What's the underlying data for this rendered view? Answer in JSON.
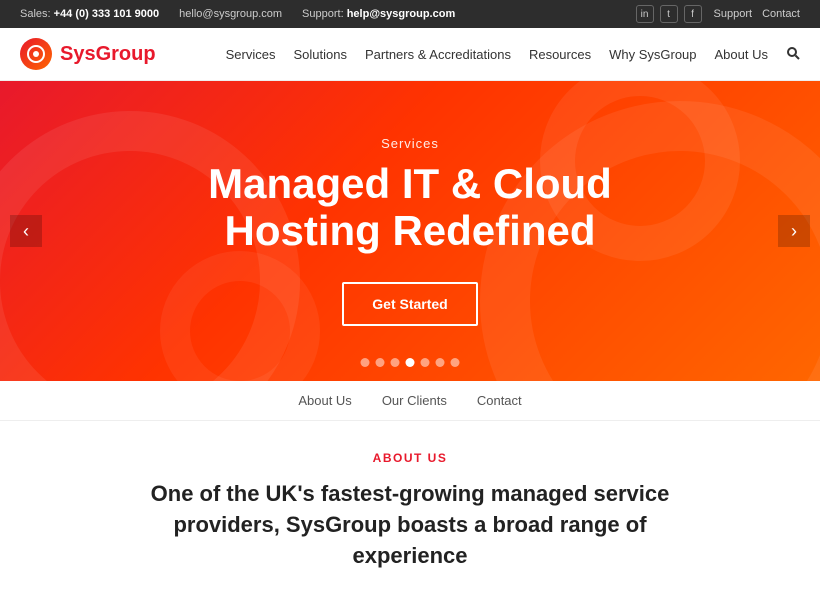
{
  "topbar": {
    "sales_label": "Sales:",
    "sales_phone": "+44 (0) 333 101 9000",
    "email_label": "hello@sysgroup.com",
    "support_label": "Support:",
    "support_email": "help@sysgroup.com",
    "links": [
      "Support",
      "Contact"
    ],
    "social": [
      "in",
      "t",
      "f"
    ]
  },
  "header": {
    "logo_text_sys": "Sys",
    "logo_text_group": "Group",
    "nav_items": [
      "Services",
      "Solutions",
      "Partners & Accreditations",
      "Resources",
      "Why SysGroup",
      "About Us"
    ]
  },
  "hero": {
    "subtitle": "Services",
    "title_line1": "Managed IT & Cloud",
    "title_line2": "Hosting Redefined",
    "cta_label": "Get Started",
    "arrow_left": "‹",
    "arrow_right": "›",
    "dots_count": 7,
    "active_dot": 3
  },
  "secondary_nav": {
    "items": [
      "About Us",
      "Our Clients",
      "Contact"
    ]
  },
  "about": {
    "label": "About Us",
    "text": "One of the UK's fastest-growing managed service providers, SysGroup boasts a broad range of experience"
  }
}
